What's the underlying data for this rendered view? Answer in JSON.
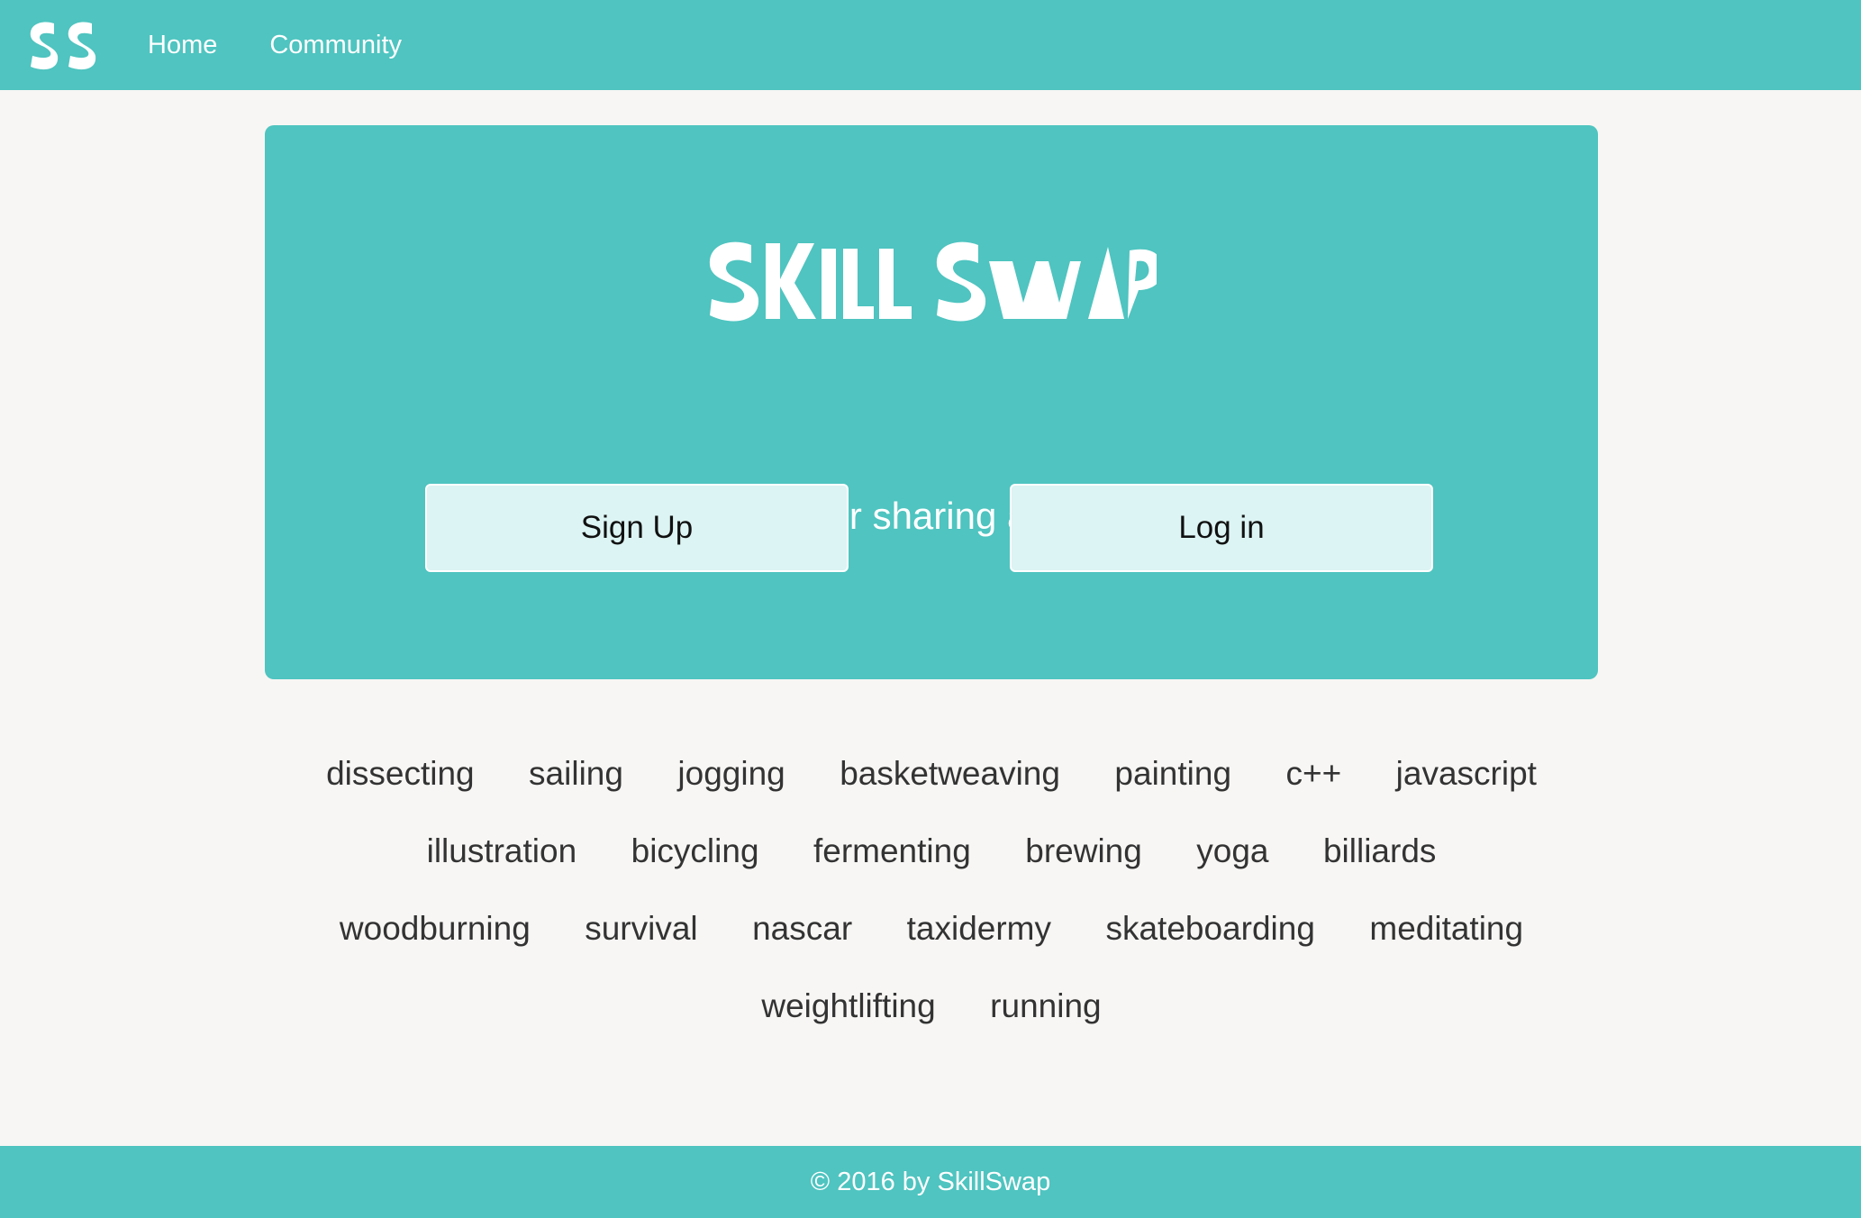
{
  "nav": {
    "logo_text": "SS",
    "links": [
      {
        "label": "Home"
      },
      {
        "label": "Community"
      }
    ]
  },
  "hero": {
    "logo_text": "SKILL SWAP",
    "tagline": "A platform for sharing and learning.",
    "signup_label": "Sign Up",
    "login_label": "Log in"
  },
  "skills": [
    "dissecting",
    "sailing",
    "jogging",
    "basketweaving",
    "painting",
    "c++",
    "javascript",
    "illustration",
    "bicycling",
    "fermenting",
    "brewing",
    "yoga",
    "billiards",
    "woodburning",
    "survival",
    "nascar",
    "taxidermy",
    "skateboarding",
    "meditating",
    "weightlifting",
    "running"
  ],
  "footer": {
    "copyright": "© 2016 by SkillSwap"
  },
  "colors": {
    "brand": "#4fc4c0",
    "background": "#f7f6f4",
    "button": "#dcf4f3",
    "text": "#333333"
  }
}
